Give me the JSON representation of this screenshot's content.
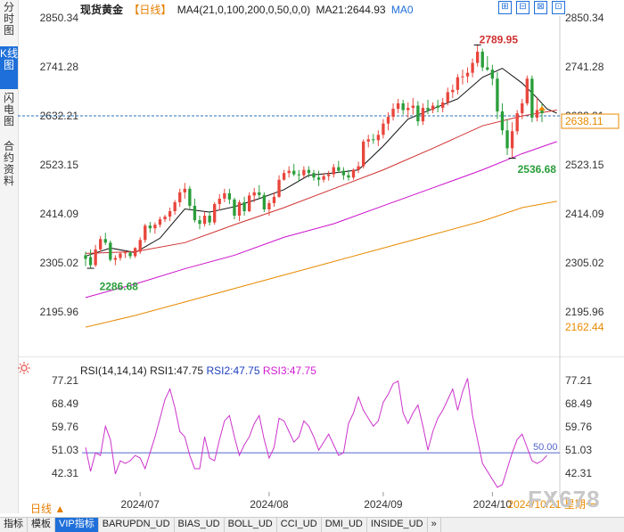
{
  "side_tabs": [
    {
      "label": "分时图",
      "active": false
    },
    {
      "label": "K线图",
      "active": true
    },
    {
      "label": "闪电图",
      "active": false
    },
    {
      "label": "合约资料",
      "active": false
    }
  ],
  "header": {
    "title": "现货黄金",
    "period": "【日线】",
    "ma4": "MA4(21,0,100,200,0,50,0,0)",
    "ma21": "MA21:2644.93",
    "ma0": "MA0"
  },
  "window_buttons": [
    "⊞",
    "⊟",
    "⊠",
    "⊡"
  ],
  "price_axis_labels": [
    "2850.34",
    "2741.28",
    "2632.21",
    "2523.15",
    "2414.09",
    "2305.02",
    "2195.96"
  ],
  "current_price": "2638.11",
  "ma200_value": "2162.44",
  "annotations": {
    "high": "2789.95",
    "low1": "2286.68",
    "low2": "2536.68"
  },
  "rsi_header": {
    "name": "RSI(14,14,14)",
    "rsi1": "RSI1:47.75",
    "rsi2": "RSI2:47.75",
    "rsi3": "RSI3:47.75"
  },
  "rsi_axis_labels": [
    "77.21",
    "68.49",
    "59.76",
    "51.03",
    "42.31"
  ],
  "rsi_level": "50.00",
  "time_labels": [
    "2024/07",
    "2024/08",
    "2024/09",
    "2024/10",
    "2024/10/21 星期一"
  ],
  "period_selector": "日线 ▲",
  "bottom_tabs": [
    {
      "label": "指标",
      "active": false
    },
    {
      "label": "模板",
      "active": false
    },
    {
      "label": "VIP指标",
      "active": true
    },
    {
      "label": "BARUPDN_UD",
      "active": false
    },
    {
      "label": "BIAS_UD",
      "active": false
    },
    {
      "label": "BOLL_UD",
      "active": false
    },
    {
      "label": "CCI_UD",
      "active": false
    },
    {
      "label": "DMI_UD",
      "active": false
    },
    {
      "label": "INSIDE_UD",
      "active": false
    },
    {
      "label": "»",
      "active": false
    }
  ],
  "watermark": "FX678",
  "colors": {
    "up": "#e8463c",
    "down": "#2a9e3a",
    "ma_black": "#111111",
    "ma_red": "#d03030",
    "ma_magenta": "#cc10cc",
    "ma_orange": "#e88a00",
    "rsi_line": "#cc33cc",
    "rsi_level": "#5566cc",
    "price_line": "#2a6fb5"
  },
  "chart_data": {
    "type": "candlestick",
    "title": "现货黄金",
    "period": "日线",
    "ylim": [
      2150,
      2860
    ],
    "start_date": "2024-06-14",
    "end_date": "2024-10-21",
    "candles": [
      [
        2322,
        2330,
        2298,
        2314
      ],
      [
        2318,
        2335,
        2294,
        2300
      ],
      [
        2300,
        2345,
        2296,
        2335
      ],
      [
        2335,
        2365,
        2330,
        2358
      ],
      [
        2358,
        2372,
        2345,
        2350
      ],
      [
        2350,
        2355,
        2308,
        2312
      ],
      [
        2312,
        2322,
        2300,
        2316
      ],
      [
        2316,
        2330,
        2310,
        2326
      ],
      [
        2326,
        2332,
        2316,
        2328
      ],
      [
        2328,
        2332,
        2314,
        2320
      ],
      [
        2320,
        2340,
        2316,
        2338
      ],
      [
        2330,
        2362,
        2325,
        2356
      ],
      [
        2356,
        2392,
        2350,
        2388
      ],
      [
        2388,
        2396,
        2372,
        2382
      ],
      [
        2382,
        2395,
        2370,
        2390
      ],
      [
        2390,
        2408,
        2384,
        2402
      ],
      [
        2402,
        2412,
        2396,
        2408
      ],
      [
        2408,
        2428,
        2398,
        2420
      ],
      [
        2420,
        2445,
        2412,
        2440
      ],
      [
        2440,
        2470,
        2430,
        2462
      ],
      [
        2462,
        2483,
        2448,
        2470
      ],
      [
        2470,
        2476,
        2425,
        2432
      ],
      [
        2432,
        2448,
        2395,
        2400
      ],
      [
        2400,
        2410,
        2380,
        2392
      ],
      [
        2392,
        2418,
        2386,
        2410
      ],
      [
        2410,
        2420,
        2388,
        2395
      ],
      [
        2395,
        2440,
        2390,
        2436
      ],
      [
        2436,
        2458,
        2422,
        2448
      ],
      [
        2448,
        2470,
        2440,
        2460
      ],
      [
        2460,
        2470,
        2436,
        2446
      ],
      [
        2446,
        2450,
        2402,
        2410
      ],
      [
        2410,
        2445,
        2398,
        2440
      ],
      [
        2440,
        2452,
        2410,
        2420
      ],
      [
        2420,
        2462,
        2418,
        2455
      ],
      [
        2455,
        2472,
        2440,
        2462
      ],
      [
        2462,
        2478,
        2448,
        2456
      ],
      [
        2456,
        2462,
        2418,
        2424
      ],
      [
        2424,
        2445,
        2410,
        2438
      ],
      [
        2438,
        2462,
        2430,
        2452
      ],
      [
        2452,
        2500,
        2450,
        2490
      ],
      [
        2490,
        2512,
        2488,
        2505
      ],
      [
        2505,
        2520,
        2495,
        2510
      ],
      [
        2510,
        2525,
        2498,
        2502
      ],
      [
        2502,
        2512,
        2486,
        2500
      ],
      [
        2500,
        2520,
        2494,
        2512
      ],
      [
        2512,
        2520,
        2495,
        2505
      ],
      [
        2505,
        2512,
        2488,
        2495
      ],
      [
        2495,
        2510,
        2476,
        2490
      ],
      [
        2490,
        2505,
        2484,
        2498
      ],
      [
        2498,
        2510,
        2488,
        2502
      ],
      [
        2502,
        2525,
        2495,
        2518
      ],
      [
        2518,
        2532,
        2505,
        2510
      ],
      [
        2510,
        2518,
        2490,
        2500
      ],
      [
        2500,
        2512,
        2488,
        2495
      ],
      [
        2495,
        2515,
        2490,
        2512
      ],
      [
        2512,
        2530,
        2505,
        2520
      ],
      [
        2520,
        2580,
        2515,
        2575
      ],
      [
        2575,
        2590,
        2562,
        2580
      ],
      [
        2580,
        2592,
        2570,
        2578
      ],
      [
        2578,
        2600,
        2565,
        2590
      ],
      [
        2590,
        2625,
        2582,
        2615
      ],
      [
        2615,
        2640,
        2600,
        2630
      ],
      [
        2630,
        2660,
        2622,
        2648
      ],
      [
        2648,
        2670,
        2638,
        2660
      ],
      [
        2660,
        2668,
        2635,
        2645
      ],
      [
        2645,
        2662,
        2628,
        2650
      ],
      [
        2650,
        2672,
        2635,
        2655
      ],
      [
        2655,
        2665,
        2610,
        2620
      ],
      [
        2620,
        2660,
        2612,
        2650
      ],
      [
        2650,
        2668,
        2636,
        2645
      ],
      [
        2645,
        2662,
        2638,
        2655
      ],
      [
        2655,
        2668,
        2640,
        2650
      ],
      [
        2650,
        2672,
        2640,
        2662
      ],
      [
        2662,
        2695,
        2655,
        2685
      ],
      [
        2685,
        2702,
        2672,
        2690
      ],
      [
        2690,
        2725,
        2680,
        2718
      ],
      [
        2718,
        2735,
        2702,
        2720
      ],
      [
        2720,
        2740,
        2706,
        2728
      ],
      [
        2728,
        2760,
        2718,
        2750
      ],
      [
        2750,
        2790,
        2742,
        2775
      ],
      [
        2775,
        2782,
        2732,
        2740
      ],
      [
        2740,
        2765,
        2732,
        2735
      ],
      [
        2735,
        2746,
        2700,
        2715
      ],
      [
        2715,
        2730,
        2625,
        2642
      ],
      [
        2642,
        2660,
        2590,
        2600
      ],
      [
        2600,
        2625,
        2545,
        2560
      ],
      [
        2560,
        2618,
        2537,
        2598
      ],
      [
        2598,
        2645,
        2590,
        2638
      ],
      [
        2638,
        2670,
        2625,
        2660
      ],
      [
        2660,
        2722,
        2655,
        2715
      ],
      [
        2715,
        2722,
        2618,
        2628
      ],
      [
        2628,
        2672,
        2620,
        2645
      ],
      [
        2645,
        2660,
        2618,
        2638
      ]
    ],
    "ma_series": [
      {
        "color": "#111111",
        "values": [
          [
            0,
            2320
          ],
          [
            5,
            2338
          ],
          [
            10,
            2328
          ],
          [
            15,
            2360
          ],
          [
            20,
            2425
          ],
          [
            25,
            2418
          ],
          [
            30,
            2430
          ],
          [
            35,
            2448
          ],
          [
            40,
            2468
          ],
          [
            45,
            2500
          ],
          [
            50,
            2505
          ],
          [
            55,
            2512
          ],
          [
            60,
            2565
          ],
          [
            65,
            2625
          ],
          [
            70,
            2648
          ],
          [
            75,
            2670
          ],
          [
            80,
            2718
          ],
          [
            84,
            2738
          ],
          [
            88,
            2705
          ],
          [
            91,
            2672
          ],
          [
            93,
            2648
          ],
          [
            95,
            2638
          ]
        ]
      },
      {
        "color": "#d03030",
        "values": [
          [
            0,
            2326
          ],
          [
            10,
            2330
          ],
          [
            20,
            2350
          ],
          [
            30,
            2390
          ],
          [
            40,
            2428
          ],
          [
            50,
            2470
          ],
          [
            60,
            2512
          ],
          [
            70,
            2560
          ],
          [
            80,
            2610
          ],
          [
            88,
            2632
          ],
          [
            95,
            2645
          ]
        ]
      },
      {
        "color": "#cc10cc",
        "values": [
          [
            0,
            2228
          ],
          [
            10,
            2258
          ],
          [
            20,
            2292
          ],
          [
            30,
            2322
          ],
          [
            40,
            2362
          ],
          [
            50,
            2392
          ],
          [
            60,
            2432
          ],
          [
            70,
            2472
          ],
          [
            80,
            2512
          ],
          [
            88,
            2548
          ],
          [
            95,
            2575
          ]
        ]
      },
      {
        "color": "#e88a00",
        "values": [
          [
            0,
            2162
          ],
          [
            10,
            2188
          ],
          [
            20,
            2218
          ],
          [
            30,
            2248
          ],
          [
            40,
            2278
          ],
          [
            50,
            2308
          ],
          [
            60,
            2338
          ],
          [
            70,
            2368
          ],
          [
            80,
            2398
          ],
          [
            88,
            2428
          ],
          [
            95,
            2442
          ]
        ]
      }
    ],
    "rsi": {
      "ylim": [
        36,
        80
      ],
      "level": 50,
      "values": [
        52,
        43,
        50,
        49,
        60,
        55,
        42,
        47,
        46,
        47,
        49,
        48,
        44,
        50,
        56,
        63,
        70,
        74,
        67,
        58,
        56,
        49,
        44,
        44,
        56,
        48,
        47,
        55,
        62,
        64,
        56,
        49,
        53,
        56,
        61,
        64,
        55,
        48,
        52,
        63,
        62,
        58,
        54,
        56,
        62,
        60,
        56,
        51,
        54,
        57,
        53,
        49,
        50,
        61,
        65,
        71,
        66,
        63,
        60,
        62,
        69,
        72,
        76,
        77,
        65,
        61,
        65,
        68,
        60,
        51,
        58,
        63,
        66,
        70,
        74,
        66,
        73,
        78,
        64,
        55,
        46,
        43,
        40,
        37,
        38,
        44,
        50,
        55,
        57,
        52,
        47,
        46,
        47,
        49
      ]
    }
  }
}
